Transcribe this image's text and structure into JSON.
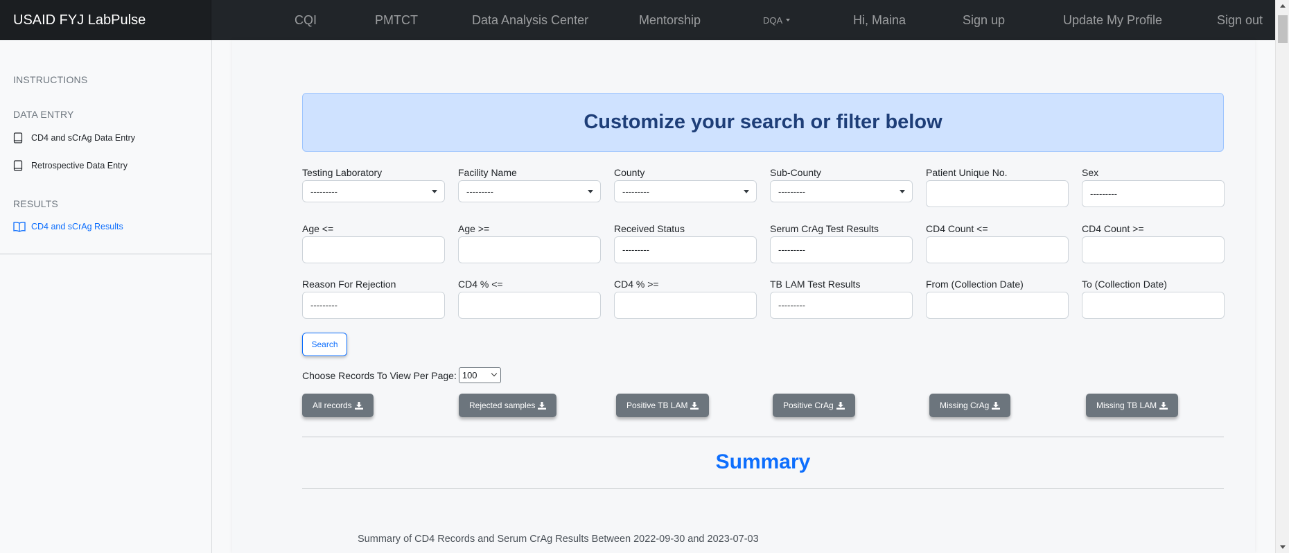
{
  "navbar": {
    "brand": "USAID FYJ LabPulse",
    "items": [
      {
        "label": "CQI"
      },
      {
        "label": "PMTCT"
      },
      {
        "label": "Data Analysis Center"
      },
      {
        "label": "Mentorship"
      },
      {
        "label": "DQA"
      },
      {
        "label": "Hi, Maina"
      },
      {
        "label": "Sign up"
      },
      {
        "label": "Update My Profile"
      },
      {
        "label": "Sign out"
      }
    ]
  },
  "sidebar": {
    "instructions": "INSTRUCTIONS",
    "data_entry_heading": "DATA ENTRY",
    "data_entry_links": [
      {
        "label": "CD4 and sCrAg Data Entry",
        "icon": "book-icon"
      },
      {
        "label": "Retrospective Data Entry",
        "icon": "book-icon"
      }
    ],
    "results_heading": "RESULTS",
    "results_links": [
      {
        "label": "CD4 and sCrAg Results",
        "icon": "open-book-icon"
      }
    ]
  },
  "banner": {
    "title": "Customize your search or filter below"
  },
  "filters": {
    "row1": [
      {
        "label": "Testing Laboratory",
        "value": "---------",
        "type": "select"
      },
      {
        "label": "Facility Name",
        "value": "---------",
        "type": "select"
      },
      {
        "label": "County",
        "value": "---------",
        "type": "select"
      },
      {
        "label": "Sub-County",
        "value": "---------",
        "type": "select"
      },
      {
        "label": "Patient Unique No.",
        "value": "",
        "type": "input"
      },
      {
        "label": "Sex",
        "value": "---------",
        "type": "input"
      }
    ],
    "row2": [
      {
        "label": "Age <=",
        "value": "",
        "type": "input"
      },
      {
        "label": "Age >=",
        "value": "",
        "type": "input"
      },
      {
        "label": "Received Status",
        "value": "---------",
        "type": "input"
      },
      {
        "label": "Serum CrAg Test Results",
        "value": "---------",
        "type": "input"
      },
      {
        "label": "CD4 Count <=",
        "value": "",
        "type": "input"
      },
      {
        "label": "CD4 Count >=",
        "value": "",
        "type": "input"
      }
    ],
    "row3": [
      {
        "label": "Reason For Rejection",
        "value": "---------",
        "type": "input"
      },
      {
        "label": "CD4 % <=",
        "value": "",
        "type": "input"
      },
      {
        "label": "CD4 % >=",
        "value": "",
        "type": "input"
      },
      {
        "label": "TB LAM Test Results",
        "value": "---------",
        "type": "input"
      },
      {
        "label": "From (Collection Date)",
        "value": "",
        "type": "input"
      },
      {
        "label": "To (Collection Date)",
        "value": "",
        "type": "input"
      }
    ]
  },
  "search_button": "Search",
  "per_page": {
    "label": "Choose Records To View Per Page:",
    "value": "100"
  },
  "download_buttons": [
    {
      "label": "All records",
      "icon": "download-icon"
    },
    {
      "label": "Rejected samples",
      "icon": "download-icon"
    },
    {
      "label": "Positive TB LAM",
      "icon": "download-icon"
    },
    {
      "label": "Positive CrAg",
      "icon": "download-icon"
    },
    {
      "label": "Missing CrAg",
      "icon": "download-icon"
    },
    {
      "label": "Missing TB LAM",
      "icon": "download-icon"
    }
  ],
  "summary": {
    "title": "Summary",
    "text": "Summary of CD4 Records and Serum CrAg Results Between 2022-09-30 and 2023-07-03"
  },
  "colors": {
    "navbar": "#212529",
    "accent": "#0d6efd",
    "banner_bg": "#cfe2ff",
    "banner_text": "#1e3e78",
    "secondary_button": "#6c757d"
  }
}
